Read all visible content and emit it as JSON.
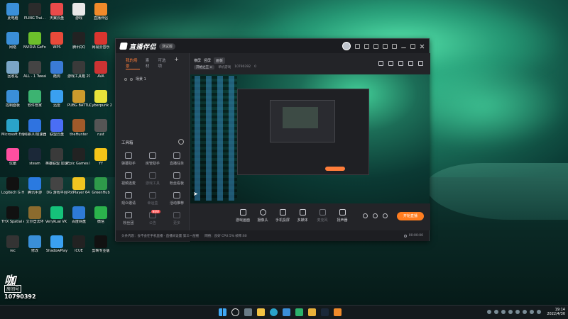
{
  "desktop": {
    "icons": [
      {
        "label": "此电脑",
        "color": "#3a8fd8"
      },
      {
        "label": "PLING Trai...",
        "color": "#2b2b2b"
      },
      {
        "label": "天翼云盘",
        "color": "#e94a4a"
      },
      {
        "label": "游戏",
        "color": "#e8e8e8"
      },
      {
        "label": "直播伴侣",
        "color": "#f08a2a"
      },
      {
        "label": "网络",
        "color": "#3a8fd8"
      },
      {
        "label": "NVIDIA GeForce Experience",
        "color": "#6cbf2b"
      },
      {
        "label": "WPS",
        "color": "#e84a3a"
      },
      {
        "label": "腾讯QQ",
        "color": "#222"
      },
      {
        "label": "网易云音乐",
        "color": "#d9352f"
      },
      {
        "label": "回收站",
        "color": "#7aa6c8"
      },
      {
        "label": "ALL - 1 Tweaker",
        "color": "#444"
      },
      {
        "label": "酷狗",
        "color": "#3a7bd5"
      },
      {
        "label": "游戏工具箱 2022",
        "color": "#3a3a3a"
      },
      {
        "label": "AVA",
        "color": "#c33"
      },
      {
        "label": "控制面板",
        "color": "#3a8fd8"
      },
      {
        "label": "软件管家",
        "color": "#3cb371"
      },
      {
        "label": "迅雷",
        "color": "#3aa0f0"
      },
      {
        "label": "PUBG BATTLEGR...",
        "color": "#cc9a2c"
      },
      {
        "label": "Cyberpunk 2077",
        "color": "#e7e33a"
      },
      {
        "label": "Microsoft Edge",
        "color": "#2aa3c9"
      },
      {
        "label": "网易UU加速器",
        "color": "#2f73e0"
      },
      {
        "label": "联盟云盘",
        "color": "#4a6ef5"
      },
      {
        "label": "theHunter",
        "color": "#a05a2a"
      },
      {
        "label": "rust",
        "color": "#555"
      },
      {
        "label": "优酷",
        "color": "#ff4fa0"
      },
      {
        "label": "steam",
        "color": "#1b2838"
      },
      {
        "label": "英雄联盟 加速器",
        "color": "#3a3a3a"
      },
      {
        "label": "Epic Games Launcher",
        "color": "#222"
      },
      {
        "label": "YY",
        "color": "#f5c518"
      },
      {
        "label": "Logitech G HUB",
        "color": "#111"
      },
      {
        "label": "腾讯手游",
        "color": "#2a7ae0"
      },
      {
        "label": "DG 游戏平台",
        "color": "#444"
      },
      {
        "label": "PotPlayer 64 bit",
        "color": "#f0c420"
      },
      {
        "label": "GreenHub",
        "color": "#2e9a4a"
      },
      {
        "label": "THX Spatial Audio",
        "color": "#111"
      },
      {
        "label": "艾尔登法环",
        "color": "#8b6b2e"
      },
      {
        "label": "VeryKuai VK 加速器",
        "color": "#15c27a"
      },
      {
        "label": "百度网盘",
        "color": "#2e7bd6"
      },
      {
        "label": "微信",
        "color": "#2bb24c"
      },
      {
        "label": "rec",
        "color": "#333"
      },
      {
        "label": "修改",
        "color": "#3a8fd8"
      },
      {
        "label": "ShadowPlay",
        "color": "#3aa0f0"
      },
      {
        "label": "iCUE",
        "color": "#222"
      },
      {
        "label": "剪映专业版",
        "color": "#111"
      }
    ]
  },
  "app": {
    "title": "直播伴侣",
    "version": "测试版",
    "left_tabs": [
      "我的场景",
      "素材",
      "可选项"
    ],
    "scene": "场景 1",
    "tools_header": "工具箱",
    "tools": [
      {
        "label": "弹幕助手",
        "dim": false,
        "new": false
      },
      {
        "label": "房管助手",
        "dim": false,
        "new": false
      },
      {
        "label": "直播任务",
        "dim": false,
        "new": false
      },
      {
        "label": "视频连麦",
        "dim": false,
        "new": false
      },
      {
        "label": "游戏工具",
        "dim": true,
        "new": false
      },
      {
        "label": "粉丝看板",
        "dim": false,
        "new": false
      },
      {
        "label": "观众邀请",
        "dim": false,
        "new": false
      },
      {
        "label": "幸运盒",
        "dim": true,
        "new": false
      },
      {
        "label": "活动推荐",
        "dim": false,
        "new": false
      },
      {
        "label": "粉丝团",
        "dim": false,
        "new": false
      },
      {
        "label": "公告",
        "dim": true,
        "new": true
      },
      {
        "label": "更多",
        "dim": true,
        "new": false
      }
    ],
    "mode_tabs": [
      "横屏",
      "竖屏",
      "画板"
    ],
    "live_info": {
      "tag": "开始之王 ×",
      "category": "单机游戏",
      "room": "10790392",
      "viewers": "0"
    },
    "controls": [
      {
        "label": "游戏画面",
        "round": false,
        "dim": false
      },
      {
        "label": "摄像头",
        "round": true,
        "dim": false
      },
      {
        "label": "手机投屏",
        "round": false,
        "dim": false
      },
      {
        "label": "多媒体",
        "round": false,
        "dim": false
      },
      {
        "label": "麦克风",
        "round": false,
        "dim": true
      },
      {
        "label": "扬声器",
        "round": false,
        "dim": false
      }
    ],
    "golive_label": "开始直播",
    "status": {
      "left": "头条内容：会不会在手机直播 · 直播间设置  第三一层楼",
      "net": "网络：良好  CPU:5%  帧率:60",
      "time": "00:00:00"
    }
  },
  "watermark": {
    "brand": "咖",
    "tag": "房间号",
    "room_id": "10790392"
  },
  "taskbar": {
    "time": "19:14",
    "date": "2022/4/30"
  }
}
